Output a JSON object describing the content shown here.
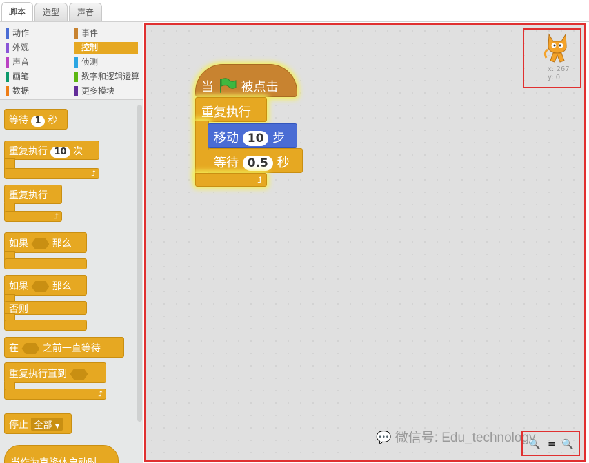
{
  "tabs": [
    {
      "label": "脚本",
      "active": true
    },
    {
      "label": "造型",
      "active": false
    },
    {
      "label": "声音",
      "active": false
    }
  ],
  "categories": [
    {
      "label": "动作",
      "color": "#4a6cd4",
      "selected": false
    },
    {
      "label": "外观",
      "color": "#8a55d7",
      "selected": false
    },
    {
      "label": "声音",
      "color": "#bb42c3",
      "selected": false
    },
    {
      "label": "画笔",
      "color": "#0e9a6c",
      "selected": false
    },
    {
      "label": "数据",
      "color": "#ee7d16",
      "selected": false
    },
    {
      "label": "事件",
      "color": "#c88330",
      "selected": false
    },
    {
      "label": "控制",
      "color": "#e6a822",
      "selected": true
    },
    {
      "label": "侦测",
      "color": "#2ca5e2",
      "selected": false
    },
    {
      "label": "数字和逻辑运算",
      "color": "#5cb712",
      "selected": false
    },
    {
      "label": "更多模块",
      "color": "#632d99",
      "selected": false
    }
  ],
  "palette": {
    "wait_label": "等待",
    "wait_value": "1",
    "wait_unit": "秒",
    "repeat_label": "重复执行",
    "repeat_value": "10",
    "repeat_unit": "次",
    "forever_label": "重复执行",
    "if_label": "如果",
    "if_then": "那么",
    "ifelse_label": "如果",
    "ifelse_then": "那么",
    "else_label": "否则",
    "waituntil_pre": "在",
    "waituntil_post": "之前一直等待",
    "repeatuntil_label": "重复执行直到",
    "stop_label": "停止",
    "stop_value": "全部",
    "clone_hat_label": "当作为克隆体启动时"
  },
  "script": {
    "hat_when": "当",
    "hat_clicked": "被点击",
    "forever_label": "重复执行",
    "move_label": "移动",
    "move_value": "10",
    "move_unit": "步",
    "wait_label": "等待",
    "wait_value": "0.5",
    "wait_unit": "秒"
  },
  "sprite_info": {
    "x": "x: 267",
    "y": "y: 0"
  },
  "zoom": {
    "out": "🔍−",
    "reset": "=",
    "in": "🔍+"
  },
  "watermark": "微信号: Edu_technology",
  "accent_colors": {
    "control": "#e6a822",
    "motion": "#4a6cd4",
    "highlight": "#e03030"
  }
}
